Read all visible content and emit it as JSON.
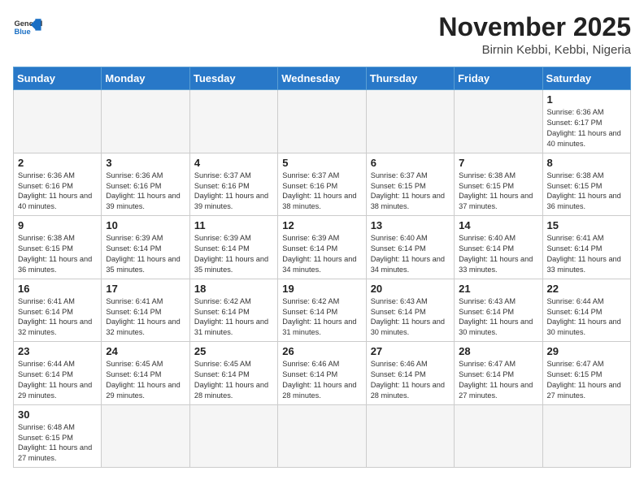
{
  "header": {
    "logo_general": "General",
    "logo_blue": "Blue",
    "month_title": "November 2025",
    "location": "Birnin Kebbi, Kebbi, Nigeria"
  },
  "weekdays": [
    "Sunday",
    "Monday",
    "Tuesday",
    "Wednesday",
    "Thursday",
    "Friday",
    "Saturday"
  ],
  "weeks": [
    [
      {
        "day": "",
        "info": ""
      },
      {
        "day": "",
        "info": ""
      },
      {
        "day": "",
        "info": ""
      },
      {
        "day": "",
        "info": ""
      },
      {
        "day": "",
        "info": ""
      },
      {
        "day": "",
        "info": ""
      },
      {
        "day": "1",
        "info": "Sunrise: 6:36 AM\nSunset: 6:17 PM\nDaylight: 11 hours and 40 minutes."
      }
    ],
    [
      {
        "day": "2",
        "info": "Sunrise: 6:36 AM\nSunset: 6:16 PM\nDaylight: 11 hours and 40 minutes."
      },
      {
        "day": "3",
        "info": "Sunrise: 6:36 AM\nSunset: 6:16 PM\nDaylight: 11 hours and 39 minutes."
      },
      {
        "day": "4",
        "info": "Sunrise: 6:37 AM\nSunset: 6:16 PM\nDaylight: 11 hours and 39 minutes."
      },
      {
        "day": "5",
        "info": "Sunrise: 6:37 AM\nSunset: 6:16 PM\nDaylight: 11 hours and 38 minutes."
      },
      {
        "day": "6",
        "info": "Sunrise: 6:37 AM\nSunset: 6:15 PM\nDaylight: 11 hours and 38 minutes."
      },
      {
        "day": "7",
        "info": "Sunrise: 6:38 AM\nSunset: 6:15 PM\nDaylight: 11 hours and 37 minutes."
      },
      {
        "day": "8",
        "info": "Sunrise: 6:38 AM\nSunset: 6:15 PM\nDaylight: 11 hours and 36 minutes."
      }
    ],
    [
      {
        "day": "9",
        "info": "Sunrise: 6:38 AM\nSunset: 6:15 PM\nDaylight: 11 hours and 36 minutes."
      },
      {
        "day": "10",
        "info": "Sunrise: 6:39 AM\nSunset: 6:14 PM\nDaylight: 11 hours and 35 minutes."
      },
      {
        "day": "11",
        "info": "Sunrise: 6:39 AM\nSunset: 6:14 PM\nDaylight: 11 hours and 35 minutes."
      },
      {
        "day": "12",
        "info": "Sunrise: 6:39 AM\nSunset: 6:14 PM\nDaylight: 11 hours and 34 minutes."
      },
      {
        "day": "13",
        "info": "Sunrise: 6:40 AM\nSunset: 6:14 PM\nDaylight: 11 hours and 34 minutes."
      },
      {
        "day": "14",
        "info": "Sunrise: 6:40 AM\nSunset: 6:14 PM\nDaylight: 11 hours and 33 minutes."
      },
      {
        "day": "15",
        "info": "Sunrise: 6:41 AM\nSunset: 6:14 PM\nDaylight: 11 hours and 33 minutes."
      }
    ],
    [
      {
        "day": "16",
        "info": "Sunrise: 6:41 AM\nSunset: 6:14 PM\nDaylight: 11 hours and 32 minutes."
      },
      {
        "day": "17",
        "info": "Sunrise: 6:41 AM\nSunset: 6:14 PM\nDaylight: 11 hours and 32 minutes."
      },
      {
        "day": "18",
        "info": "Sunrise: 6:42 AM\nSunset: 6:14 PM\nDaylight: 11 hours and 31 minutes."
      },
      {
        "day": "19",
        "info": "Sunrise: 6:42 AM\nSunset: 6:14 PM\nDaylight: 11 hours and 31 minutes."
      },
      {
        "day": "20",
        "info": "Sunrise: 6:43 AM\nSunset: 6:14 PM\nDaylight: 11 hours and 30 minutes."
      },
      {
        "day": "21",
        "info": "Sunrise: 6:43 AM\nSunset: 6:14 PM\nDaylight: 11 hours and 30 minutes."
      },
      {
        "day": "22",
        "info": "Sunrise: 6:44 AM\nSunset: 6:14 PM\nDaylight: 11 hours and 30 minutes."
      }
    ],
    [
      {
        "day": "23",
        "info": "Sunrise: 6:44 AM\nSunset: 6:14 PM\nDaylight: 11 hours and 29 minutes."
      },
      {
        "day": "24",
        "info": "Sunrise: 6:45 AM\nSunset: 6:14 PM\nDaylight: 11 hours and 29 minutes."
      },
      {
        "day": "25",
        "info": "Sunrise: 6:45 AM\nSunset: 6:14 PM\nDaylight: 11 hours and 28 minutes."
      },
      {
        "day": "26",
        "info": "Sunrise: 6:46 AM\nSunset: 6:14 PM\nDaylight: 11 hours and 28 minutes."
      },
      {
        "day": "27",
        "info": "Sunrise: 6:46 AM\nSunset: 6:14 PM\nDaylight: 11 hours and 28 minutes."
      },
      {
        "day": "28",
        "info": "Sunrise: 6:47 AM\nSunset: 6:14 PM\nDaylight: 11 hours and 27 minutes."
      },
      {
        "day": "29",
        "info": "Sunrise: 6:47 AM\nSunset: 6:15 PM\nDaylight: 11 hours and 27 minutes."
      }
    ],
    [
      {
        "day": "30",
        "info": "Sunrise: 6:48 AM\nSunset: 6:15 PM\nDaylight: 11 hours and 27 minutes."
      },
      {
        "day": "",
        "info": ""
      },
      {
        "day": "",
        "info": ""
      },
      {
        "day": "",
        "info": ""
      },
      {
        "day": "",
        "info": ""
      },
      {
        "day": "",
        "info": ""
      },
      {
        "day": "",
        "info": ""
      }
    ]
  ]
}
